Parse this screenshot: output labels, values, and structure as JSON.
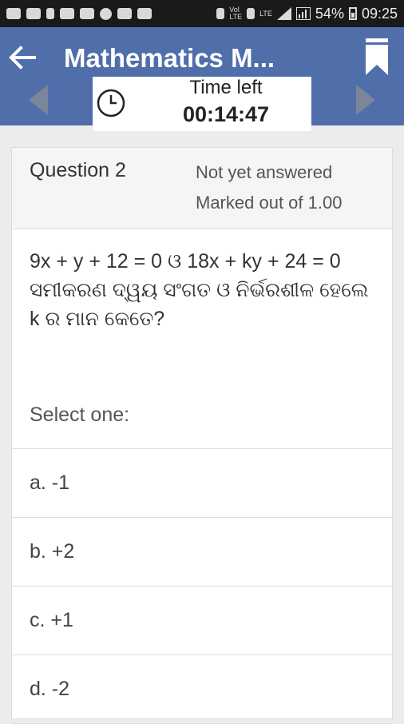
{
  "status_bar": {
    "battery": "54%",
    "time": "09:25",
    "volte": "Vol\nLTE",
    "lte": "LTE"
  },
  "app_bar": {
    "title": "Mathematics M...",
    "color": "#4f6eaa"
  },
  "timer": {
    "label": "Time left",
    "value": "00:14:47"
  },
  "question": {
    "number": "Question 2",
    "status": "Not yet answered",
    "marks": "Marked out of 1.00",
    "text": "9x + y + 12 = 0 ଓ 18x + ky + 24 = 0\nସମୀକରଣ ଦ୍ୱୟ ସଂଗତ ଓ ନିର୍ଭରଶୀଳ ହେଲେ\nk ର ମାନ କେତେ?",
    "prompt": "Select one:",
    "options": [
      "a. -1",
      "b. +2",
      "c. +1",
      "d. -2"
    ]
  }
}
